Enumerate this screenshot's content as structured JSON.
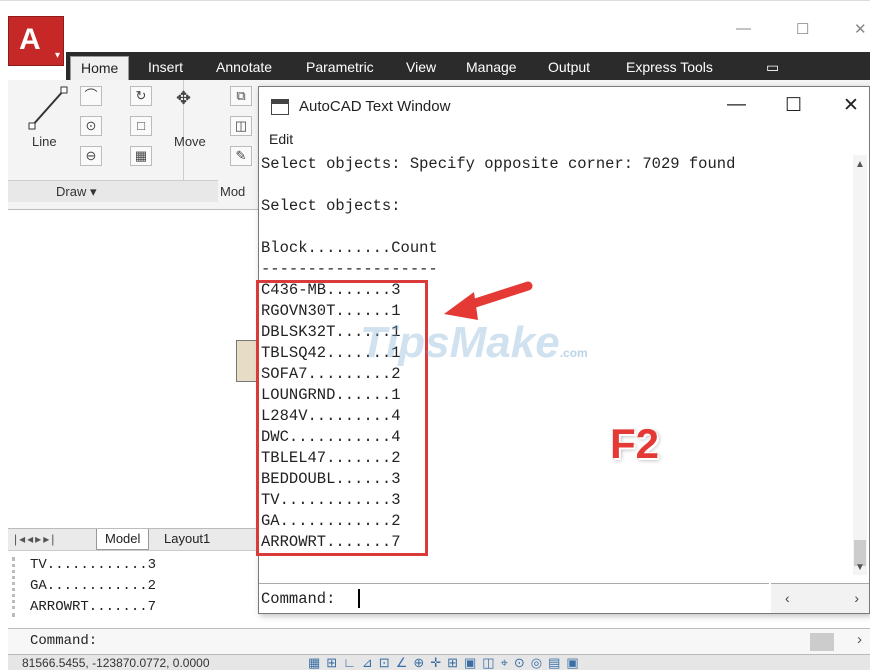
{
  "window": {
    "title": "AutoCAD Text Window",
    "minimize": "—",
    "maximize": "☐",
    "close": "✕"
  },
  "app_menu": {
    "letter": "A"
  },
  "ribbon": {
    "tabs": [
      "Home",
      "Insert",
      "Annotate",
      "Parametric",
      "View",
      "Manage",
      "Output",
      "Express Tools"
    ],
    "active_tab": "Home",
    "tools": {
      "line": "Line",
      "move": "Move"
    },
    "panels": {
      "draw": "Draw ▾",
      "modify": "Mod"
    }
  },
  "layout_tabs": [
    "Model",
    "Layout1"
  ],
  "command_history": [
    "TV............3",
    "GA............2",
    "ARROWRT.......7"
  ],
  "command_line": {
    "prompt": "Command:"
  },
  "status_bar": {
    "coordinates": "81566.5455, -123870.0772, 0.0000"
  },
  "text_window": {
    "menu": [
      "Edit"
    ],
    "lines": [
      "Select objects: Specify opposite corner: 7029 found",
      "",
      "Select objects:",
      "",
      "Block.........Count",
      "-------------------",
      "C436-MB.......3",
      "RGOVN30T......1",
      "DBLSK32T......1",
      "TBLSQ42.......1",
      "SOFA7.........2",
      "LOUNGRND......1",
      "L284V.........4",
      "DWC...........4",
      "TBLEL47.......2",
      "BEDDOUBL......3",
      "TV............3",
      "GA............2",
      "ARROWRT.......7"
    ],
    "command_prompt": "Command:"
  },
  "annotation": {
    "key": "F2",
    "color": "#e53935"
  },
  "watermark": {
    "text": "TipsMake",
    "suffix": ".com"
  },
  "colors": {
    "highlight_box": "#d93a3a",
    "ribbon_dark": "#2b2b2b",
    "app_red": "#c62828"
  }
}
